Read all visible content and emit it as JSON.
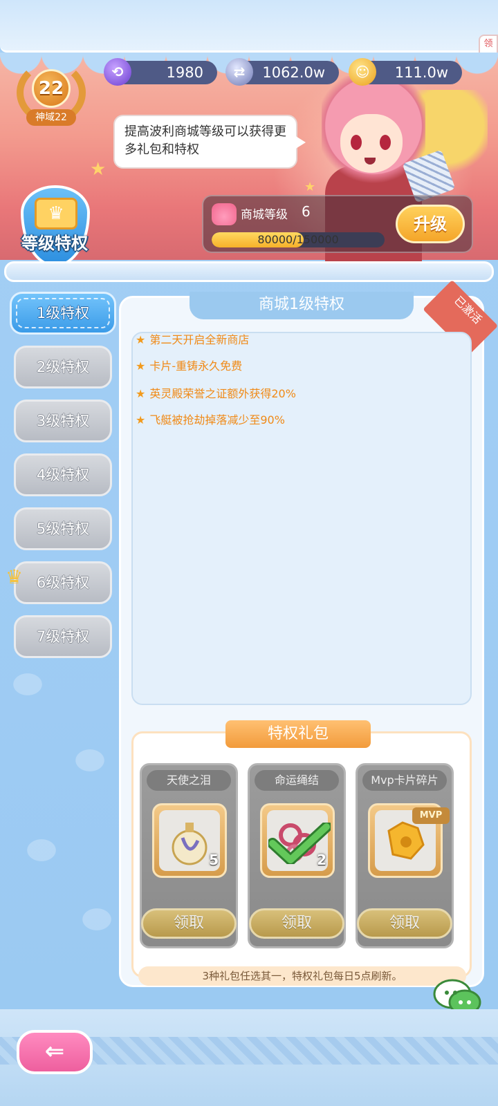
{
  "player": {
    "realm_level": "22",
    "realm_label": "神域22"
  },
  "currencies": [
    {
      "icon": "purple-gem-icon",
      "value": "1980",
      "color": "#8a5be0"
    },
    {
      "icon": "silver-coin-icon",
      "value": "1062.0w",
      "color": "#7d86b8"
    },
    {
      "icon": "gold-coin-icon",
      "value": "111.0w",
      "color": "#f2b02a"
    }
  ],
  "side_flag": "领",
  "banner": {
    "speech": "提高波利商城等级可以获得更多礼包和特权",
    "emblem_title": "等级特权",
    "shop_level_label": "商城等级",
    "shop_level_value": "6",
    "progress_text": "80000/150000",
    "progress_fraction": 0.533,
    "upgrade_button": "升级"
  },
  "tabs": [
    {
      "label": "1级特权",
      "active": true
    },
    {
      "label": "2级特权",
      "active": false
    },
    {
      "label": "3级特权",
      "active": false
    },
    {
      "label": "4级特权",
      "active": false
    },
    {
      "label": "5级特权",
      "active": false
    },
    {
      "label": "6级特权",
      "active": false,
      "current": true
    },
    {
      "label": "7级特权",
      "active": false
    }
  ],
  "panel": {
    "title": "商城1级特权",
    "status_tag": "已激活",
    "benefits": [
      "第二天开启全新商店",
      "卡片-重铸永久免费",
      "英灵殿荣誉之证额外获得20%",
      "飞艇被抢劫掉落减少至90%"
    ]
  },
  "gift": {
    "title": "特权礼包",
    "items": [
      {
        "name": "天使之泪",
        "qty": "5",
        "icon": "potion-bottle-icon",
        "button": "领取",
        "claimed": false
      },
      {
        "name": "命运绳结",
        "qty": "2",
        "icon": "rope-knot-icon",
        "button": "领取",
        "claimed": true
      },
      {
        "name": "Mvp卡片碎片",
        "qty": "",
        "icon": "card-fragment-icon",
        "button": "领取",
        "claimed": false,
        "badge": "MVP"
      }
    ],
    "note": "3种礼包任选其一，特权礼包每日5点刷新。"
  },
  "colors": {
    "accent_blue": "#3a9be8",
    "benefit_orange": "#f08a17",
    "upgrade_gold": "#f4a52a",
    "back_pink": "#ee5f9e"
  }
}
